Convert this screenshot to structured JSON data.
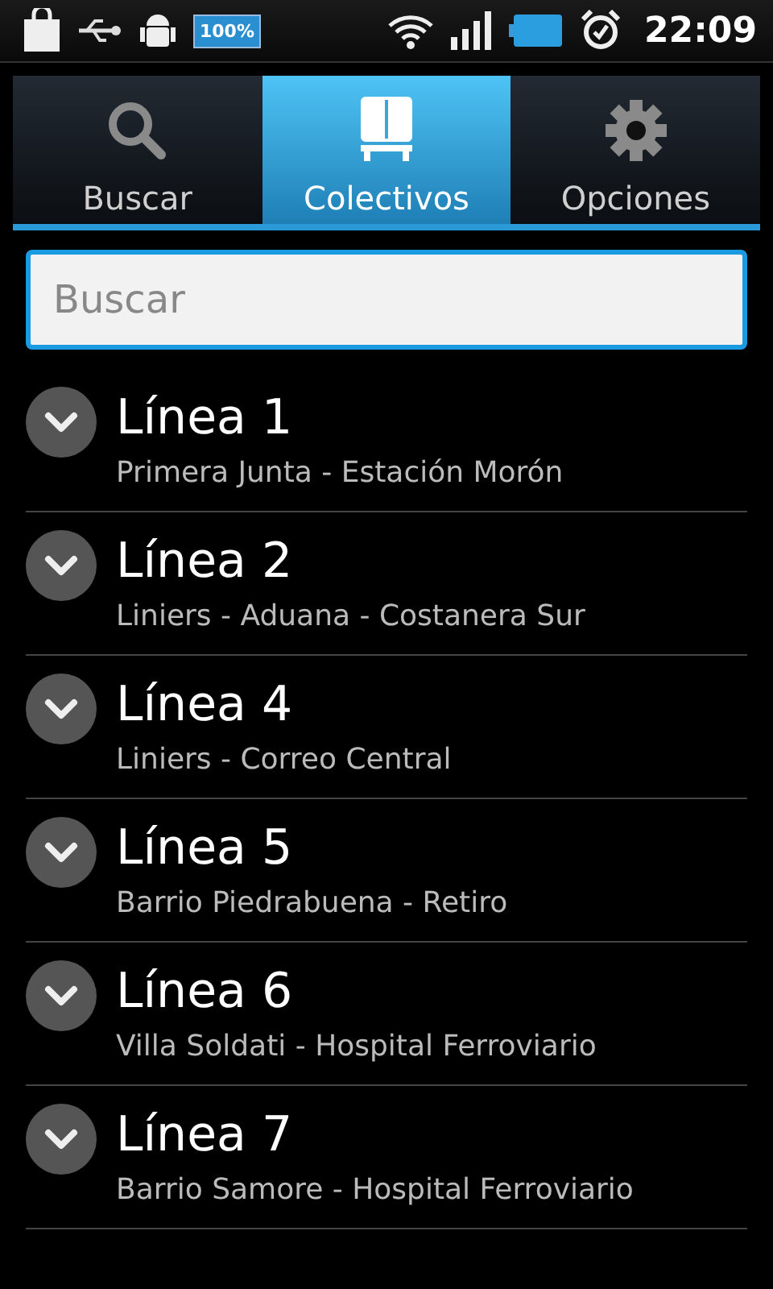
{
  "status_bar": {
    "battery_badge": "100%",
    "time": "22:09"
  },
  "tabs": [
    {
      "label": "Buscar",
      "kind": "search",
      "selected": false
    },
    {
      "label": "Colectivos",
      "kind": "bus",
      "selected": true
    },
    {
      "label": "Opciones",
      "kind": "gear",
      "selected": false
    }
  ],
  "search": {
    "placeholder": "Buscar"
  },
  "lines": [
    {
      "title": "Línea 1",
      "route": "Primera Junta - Estación Morón"
    },
    {
      "title": "Línea 2",
      "route": "Liniers - Aduana - Costanera Sur"
    },
    {
      "title": "Línea 4",
      "route": "Liniers - Correo Central"
    },
    {
      "title": "Línea 5",
      "route": "Barrio Piedrabuena - Retiro"
    },
    {
      "title": "Línea 6",
      "route": "Villa Soldati - Hospital Ferroviario"
    },
    {
      "title": "Línea 7",
      "route": "Barrio Samore - Hospital Ferroviario"
    }
  ]
}
